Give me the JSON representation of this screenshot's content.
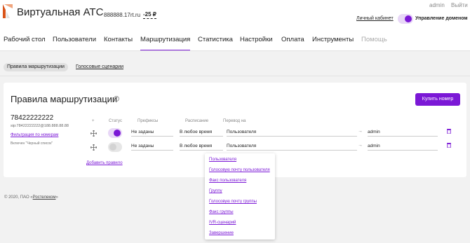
{
  "header": {
    "title": "Виртуальная АТС",
    "domain": "888888.17rt.ru",
    "balance": "-25 ₽",
    "admin": "admin",
    "logout": "Выйти",
    "cabinet_link": "Личный кабинет",
    "domain_mgmt": "Управление доменом",
    "domain_mgmt_toggle_on": true
  },
  "nav": {
    "items": [
      {
        "label": "Рабочий стол"
      },
      {
        "label": "Пользователи"
      },
      {
        "label": "Контакты"
      },
      {
        "label": "Маршрутизация",
        "active": true
      },
      {
        "label": "Статистика"
      },
      {
        "label": "Настройки"
      },
      {
        "label": "Оплата"
      },
      {
        "label": "Инструменты"
      },
      {
        "label": "Помощь",
        "disabled": true
      }
    ]
  },
  "subnav": {
    "active": "Правила маршрутизации",
    "link": "Голосовые сценарии"
  },
  "card": {
    "title": "Правила маршрутизации",
    "info_icon": "info-icon",
    "buy_button": "Купить номер",
    "number": "78422222222",
    "sip": "sip:78422222222@188.888.88.88",
    "filter_link": "Фильтрация по номерам",
    "blacklist_note": "Включен \"Черный список\"",
    "columns": {
      "plus": "+",
      "status": "Статус",
      "prefixes": "Префиксы",
      "schedule": "Расписание",
      "forward": "Перевод на"
    },
    "rules": [
      {
        "status_on": true,
        "prefixes": "Не заданы",
        "schedule": "В любое время",
        "target": "Пользователя",
        "arrow": "→",
        "user": "admin"
      },
      {
        "status_on": false,
        "prefixes": "Не заданы",
        "schedule": "В любое время",
        "target": "Пользователя",
        "arrow": "→",
        "user": "admin"
      }
    ],
    "add_rule": "Добавить правило"
  },
  "dropdown": {
    "options": [
      "Пользователя",
      "Голосовую почту пользователя",
      "Факс пользователя",
      "Группу",
      "Голосовую почту группы",
      "Факс группы",
      "IVR-сценарий",
      "Завершение"
    ]
  },
  "footer": {
    "text": "© 2020, ПАО «",
    "link": "Ростелеком",
    "text_end": "»"
  },
  "colors": {
    "accent": "#7b18d6",
    "background": "#f2f2f2",
    "logo": "#d9541a"
  }
}
